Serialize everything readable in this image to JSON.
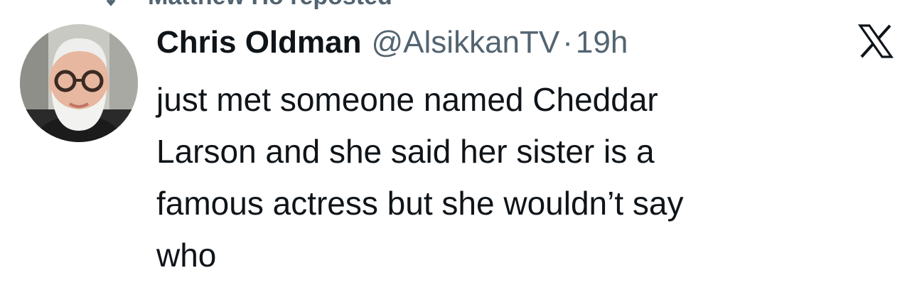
{
  "repost_banner": {
    "label": "Matthew Ho reposted",
    "icon": "repost-icon"
  },
  "tweet": {
    "author": {
      "display_name": "Chris Oldman",
      "handle": "@AlsikkanTV",
      "avatar_icon": "avatar"
    },
    "separator": "·",
    "time": "19h",
    "text": "just met someone named Cheddar\nLarson and she said her sister is a\nfamous actress but she wouldn’t say\nwho",
    "platform_icon": "x-logo-icon"
  },
  "colors": {
    "primary_text": "#0f1419",
    "secondary_text": "#536471",
    "background": "#ffffff"
  }
}
